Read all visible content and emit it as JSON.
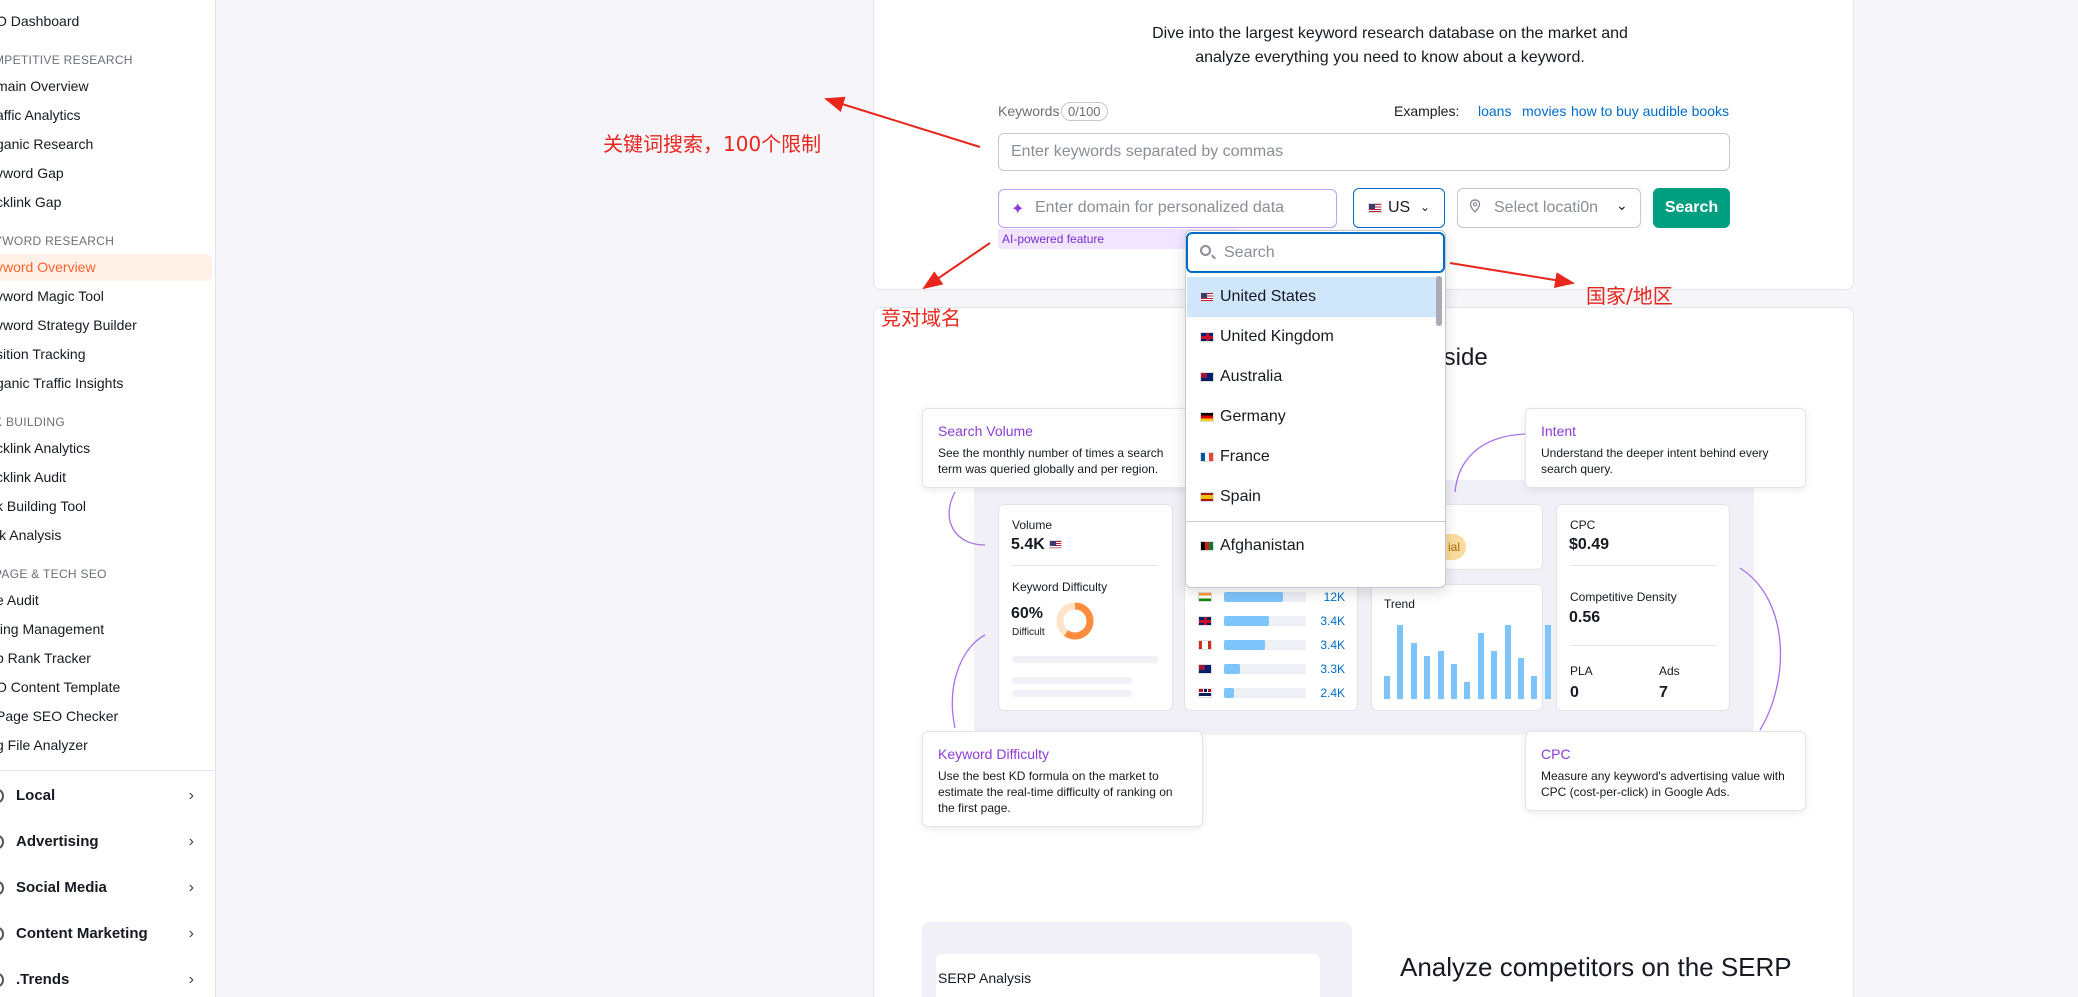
{
  "sidebar": {
    "items": [
      {
        "label": "SEO Dashboard",
        "display": "O Dashboard"
      },
      {
        "label": "COMPETITIVE RESEARCH",
        "display": "MPETITIVE RESEARCH"
      },
      {
        "label": "Domain Overview",
        "display": "main Overview"
      },
      {
        "label": "Traffic Analytics",
        "display": "affic Analytics"
      },
      {
        "label": "Organic Research",
        "display": "ganic Research"
      },
      {
        "label": "Keyword Gap",
        "display": "yword Gap"
      },
      {
        "label": "Backlink Gap",
        "display": "cklink Gap"
      },
      {
        "label": "KEYWORD RESEARCH",
        "display": "YWORD RESEARCH"
      },
      {
        "label": "Keyword Overview",
        "display": "yword Overview"
      },
      {
        "label": "Keyword Magic Tool",
        "display": "yword Magic Tool"
      },
      {
        "label": "Keyword Strategy Builder",
        "display": "yword Strategy Builder"
      },
      {
        "label": "Position Tracking",
        "display": "sition Tracking"
      },
      {
        "label": "Organic Traffic Insights",
        "display": "ganic Traffic Insights"
      },
      {
        "label": "LINK BUILDING",
        "display": "K BUILDING"
      },
      {
        "label": "Backlink Analytics",
        "display": "cklink Analytics"
      },
      {
        "label": "Backlink Audit",
        "display": "cklink Audit"
      },
      {
        "label": "Link Building Tool",
        "display": "k Building Tool"
      },
      {
        "label": "Bulk Analysis",
        "display": "lk Analysis"
      },
      {
        "label": "ON PAGE & TECH SEO",
        "display": "PAGE & TECH SEO"
      },
      {
        "label": "Site Audit",
        "display": "e Audit"
      },
      {
        "label": "Listing Management",
        "display": "ting Management"
      },
      {
        "label": "Map Rank Tracker",
        "display": "p Rank Tracker"
      },
      {
        "label": "SEO Content Template",
        "display": "O Content Template"
      },
      {
        "label": "On Page SEO Checker",
        "display": "Page SEO Checker"
      },
      {
        "label": "Log File Analyzer",
        "display": "g File Analyzer"
      }
    ],
    "groups": [
      {
        "label": "Local"
      },
      {
        "label": "Advertising"
      },
      {
        "label": "Social Media"
      },
      {
        "label": "Content Marketing"
      },
      {
        "label": ".Trends"
      }
    ]
  },
  "hero": {
    "description_line1": "Dive into the largest keyword research database on the market and",
    "description_line2": "analyze everything you need to know about a keyword."
  },
  "search_form": {
    "keywords_label": "Keywords",
    "keywords_count": "0/100",
    "examples_label": "Examples:",
    "examples": [
      "loans",
      "movies",
      "how to buy audible books"
    ],
    "keywords_placeholder": "Enter keywords separated by commas",
    "domain_placeholder": "Enter domain for personalized data",
    "ai_tag": "AI-powered feature",
    "country_value": "US",
    "location_placeholder": "Select locati0n",
    "search_button": "Search"
  },
  "country_dropdown": {
    "search_placeholder": "Search",
    "options": [
      {
        "label": "United States",
        "flag": "us",
        "selected": true
      },
      {
        "label": "United Kingdom",
        "flag": "uk"
      },
      {
        "label": "Australia",
        "flag": "au"
      },
      {
        "label": "Germany",
        "flag": "de"
      },
      {
        "label": "France",
        "flag": "fr"
      },
      {
        "label": "Spain",
        "flag": "es"
      },
      {
        "label": "Afghanistan",
        "flag": "af"
      }
    ]
  },
  "annotations": {
    "keyword_search": "关键词搜索，100个限制",
    "competitor_domain": "竞对域名",
    "country_region": "国家/地区"
  },
  "features": {
    "title_visible": "inside",
    "tips": {
      "search_volume": {
        "title": "Search Volume",
        "desc": "See the monthly number of times a search term was queried globally and per region."
      },
      "intent": {
        "title": "Intent",
        "desc": "Understand the deeper intent behind every search query."
      },
      "keyword_difficulty": {
        "title": "Keyword Difficulty",
        "desc": "Use the best KD formula on the market to estimate the real-time difficulty of ranking on the first page."
      },
      "cpc": {
        "title": "CPC",
        "desc": "Measure any keyword's advertising value with CPC (cost-per-click) in Google Ads."
      }
    },
    "widget": {
      "volume_label": "Volume",
      "volume_value": "5.4K",
      "kd_label": "Keyword Difficulty",
      "kd_value": "60%",
      "kd_text": "Difficult",
      "kd_level": 0.6,
      "intent_pill": "ial",
      "trend_label": "Trend",
      "trend_levels": [
        0.3,
        0.95,
        0.72,
        0.55,
        0.62,
        0.45,
        0.22,
        0.85,
        0.62,
        0.95,
        0.52,
        0.3,
        0.95,
        0.42
      ],
      "country_bars": [
        {
          "flag": "in",
          "value": "12K",
          "level": 0.72
        },
        {
          "flag": "uk",
          "value": "3.4K",
          "level": 0.55
        },
        {
          "flag": "ca",
          "value": "3.4K",
          "level": 0.5
        },
        {
          "flag": "au",
          "value": "3.3K",
          "level": 0.2
        },
        {
          "flag": "no",
          "value": "2.4K",
          "level": 0.12
        }
      ],
      "cpc_label": "CPC",
      "cpc_value": "$0.49",
      "density_label": "Competitive Density",
      "density_value": "0.56",
      "pla_label": "PLA",
      "pla_value": "0",
      "ads_label": "Ads",
      "ads_value": "7"
    }
  },
  "serp": {
    "card_label": "SERP Analysis",
    "title": "Analyze competitors on the SERP"
  },
  "colors": {
    "accent": "#ff642d",
    "link": "#006dca",
    "search_button": "#009f81",
    "annotation": "#e8261d",
    "ai_purple": "#8e3bd8"
  }
}
